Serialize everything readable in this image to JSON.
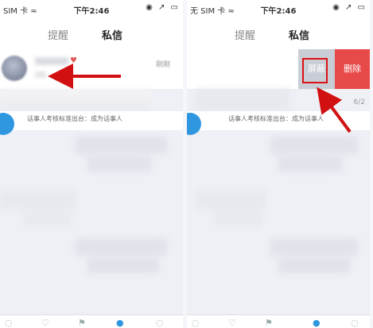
{
  "left_phone": {
    "status": {
      "carrier": "SIM 卡 ≈",
      "time": "下午2:46",
      "icons": "◉ ↗ ▭"
    },
    "tabs": {
      "reminder": "提醒",
      "messages": "私信"
    },
    "message_row": {
      "time": "刚刚"
    },
    "bottom_row_text": "话事人考核标准出台：成为话事人"
  },
  "right_phone": {
    "status": {
      "carrier": "无 SIM 卡 ≈",
      "time": "下午2:46",
      "icons": "◉ ↗ ▭"
    },
    "tabs": {
      "reminder": "提醒",
      "messages": "私信"
    },
    "actions": {
      "hide": "屏蔽",
      "delete": "删除"
    },
    "page_indicator": "6/2",
    "bottom_row_text": "话事人考核标准出台：成为话事人"
  },
  "colors": {
    "accent": "#2f97e0",
    "delete": "#e84a4a",
    "hide": "#c9cdd6",
    "annotation": "#d11111"
  }
}
